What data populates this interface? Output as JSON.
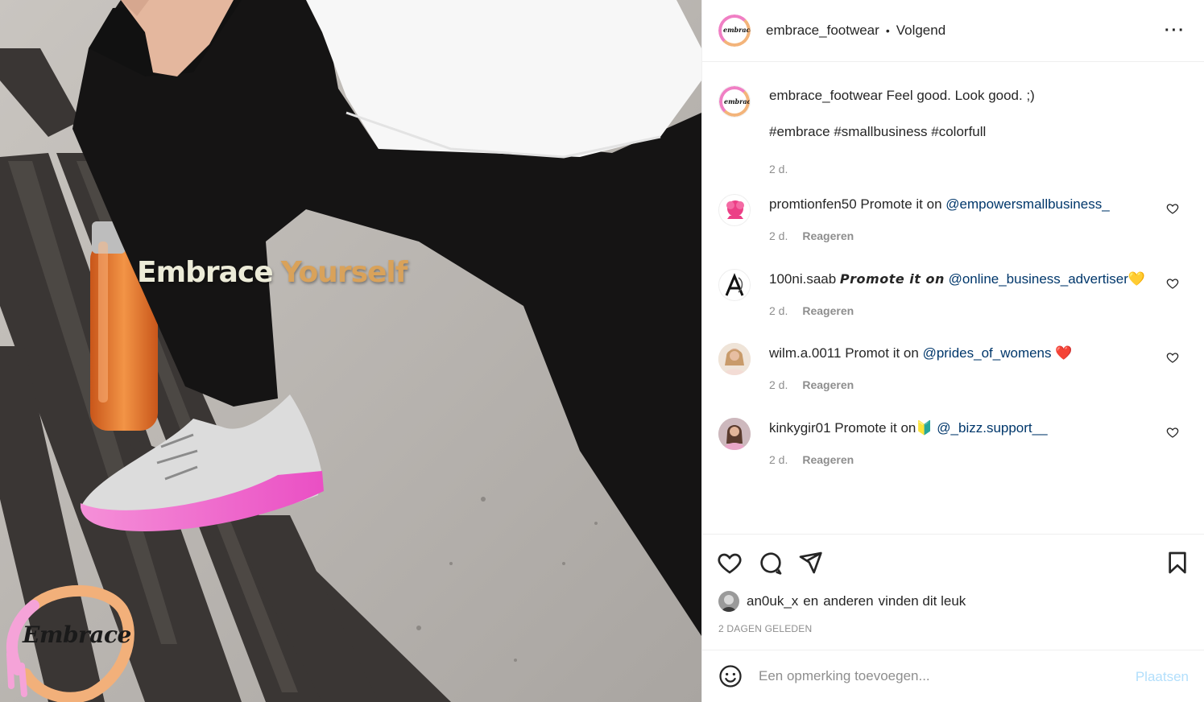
{
  "photo": {
    "overlay_word1": "Embrace",
    "overlay_word2": "Yourself",
    "logo_text": "Embrace",
    "colors": {
      "shoe_sole": "#f06bd0",
      "bottle": "#e8782a",
      "overlay_word2": "#d9a25a"
    }
  },
  "header": {
    "username": "embrace_footwear",
    "separator": "•",
    "follow_label": "Volgend",
    "more_icon": "more-horizontal-icon",
    "avatar_text": "embrace"
  },
  "caption": {
    "username": "embrace_footwear",
    "text": "Feel good. Look good. ;)",
    "hashtags": "#embrace #smallbusiness #colorfull",
    "time": "2 d."
  },
  "comments": [
    {
      "username": "promtionfen50",
      "text": "Promote it on ",
      "mention": "@empowersmallbusiness_",
      "suffix": "",
      "time": "2 d.",
      "reply": "Reageren"
    },
    {
      "username": "100ni.saab",
      "text": "𝙋𝙧𝙤𝙢𝙤𝙩𝙚 𝙞𝙩 𝙤𝙣",
      "mention": "@online_business_advertiser",
      "suffix": "💛",
      "time": "2 d.",
      "reply": "Reageren"
    },
    {
      "username": "wilm.a.0011",
      "text": "Promot it on ",
      "mention": "@prides_of_womens",
      "suffix": "❤️",
      "time": "2 d.",
      "reply": "Reageren"
    },
    {
      "username": "kinkygir01",
      "text": "Promote it on🔰 ",
      "mention": "@_bizz.support__",
      "suffix": "",
      "time": "2 d.",
      "reply": "Reageren"
    }
  ],
  "likes": {
    "user": "an0uk_x",
    "connector": "en",
    "others": "anderen",
    "suffix": "vinden dit leuk",
    "time_ago": "2 DAGEN GELEDEN"
  },
  "add_comment": {
    "placeholder": "Een opmerking toevoegen...",
    "post_label": "Plaatsen"
  }
}
